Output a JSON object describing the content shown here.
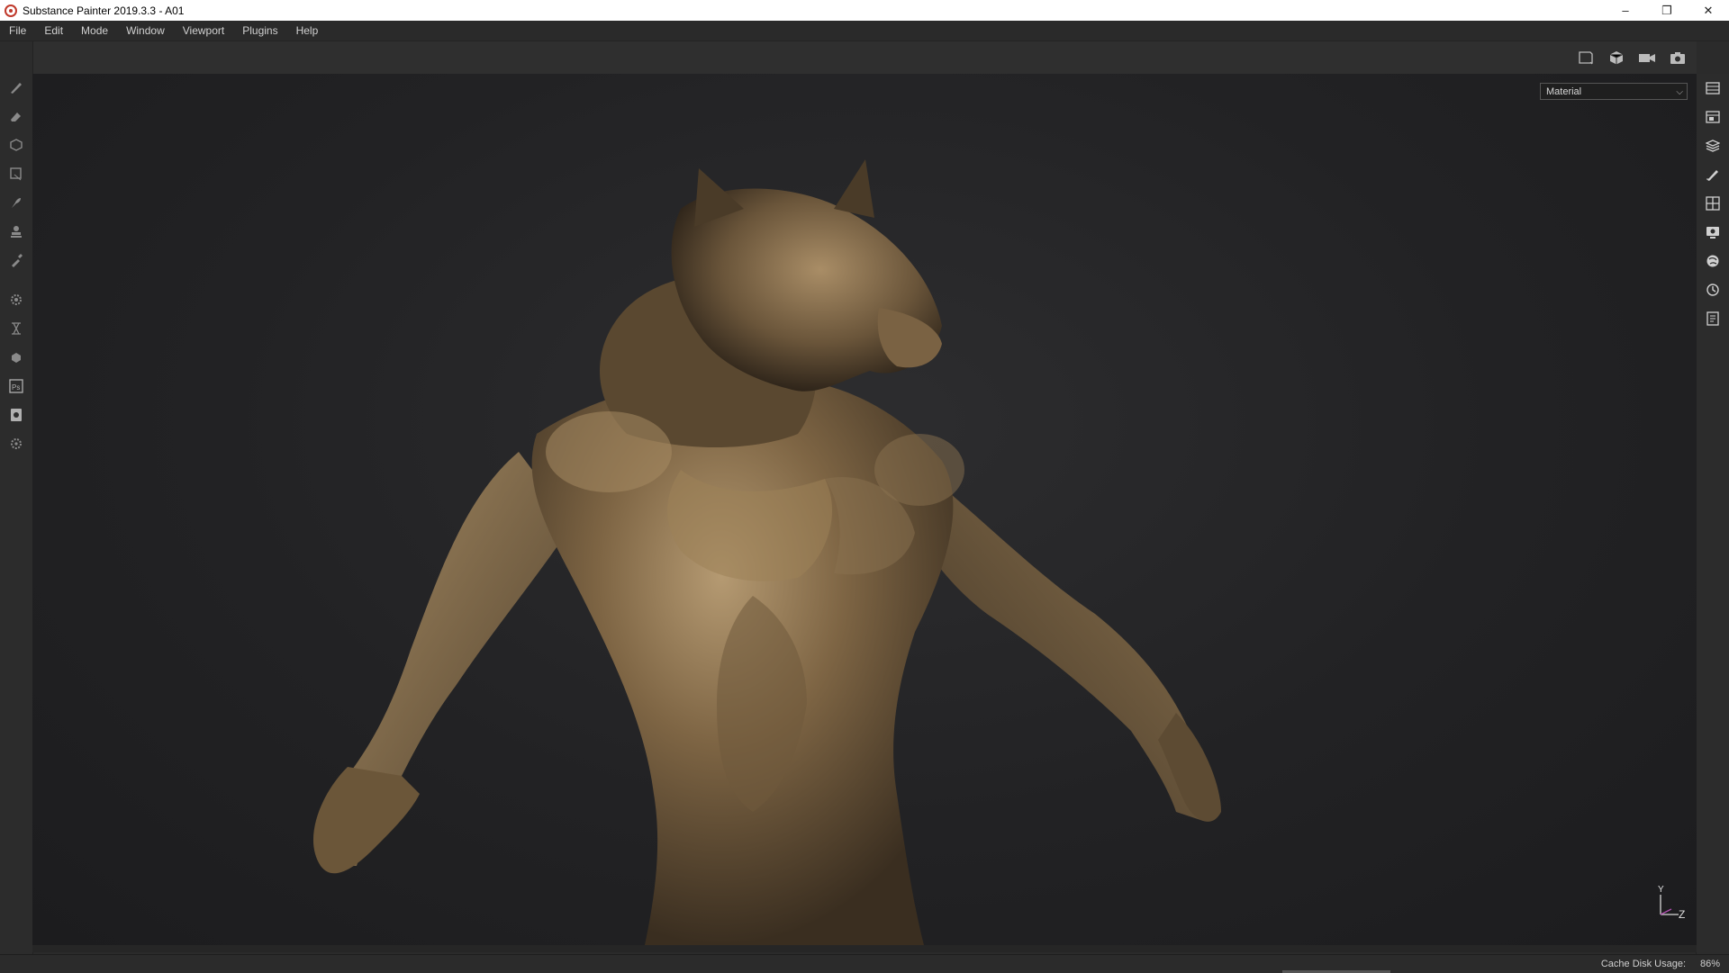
{
  "window": {
    "title": "Substance Painter 2019.3.3 - A01",
    "controls": [
      "minimize-icon",
      "restore-icon",
      "close-icon"
    ]
  },
  "menu": [
    "File",
    "Edit",
    "Mode",
    "Window",
    "Viewport",
    "Plugins",
    "Help"
  ],
  "toolbar": {
    "icons": [
      "2d-view-icon",
      "3d-view-icon",
      "camera-icon",
      "screenshot-icon"
    ]
  },
  "left_tools": [
    "paint-brush-icon",
    "eraser-icon",
    "projection-icon",
    "polygon-fill-icon",
    "smudge-icon",
    "clone-icon",
    "color-picker-icon",
    "bake-settings-icon",
    "iray-icon",
    "effects-icon",
    "photoshop-icon",
    "export-icon",
    "plugin-settings-icon"
  ],
  "right_tools": [
    "texture-set-list-icon",
    "texture-set-settings-icon",
    "layers-icon",
    "properties-icon",
    "uv-display-icon",
    "display-settings-icon",
    "shader-settings-icon",
    "history-icon",
    "log-icon"
  ],
  "viewport": {
    "channel_dropdown": "Material",
    "gizmo": {
      "y_label": "Y",
      "z_label": "Z"
    }
  },
  "status": {
    "cache_label": "Cache Disk Usage:",
    "cache_value": "86%"
  },
  "colors": {
    "bronze": "#8a7250",
    "viewport_bg": "#222224",
    "panel_bg": "#2c2c2c"
  }
}
